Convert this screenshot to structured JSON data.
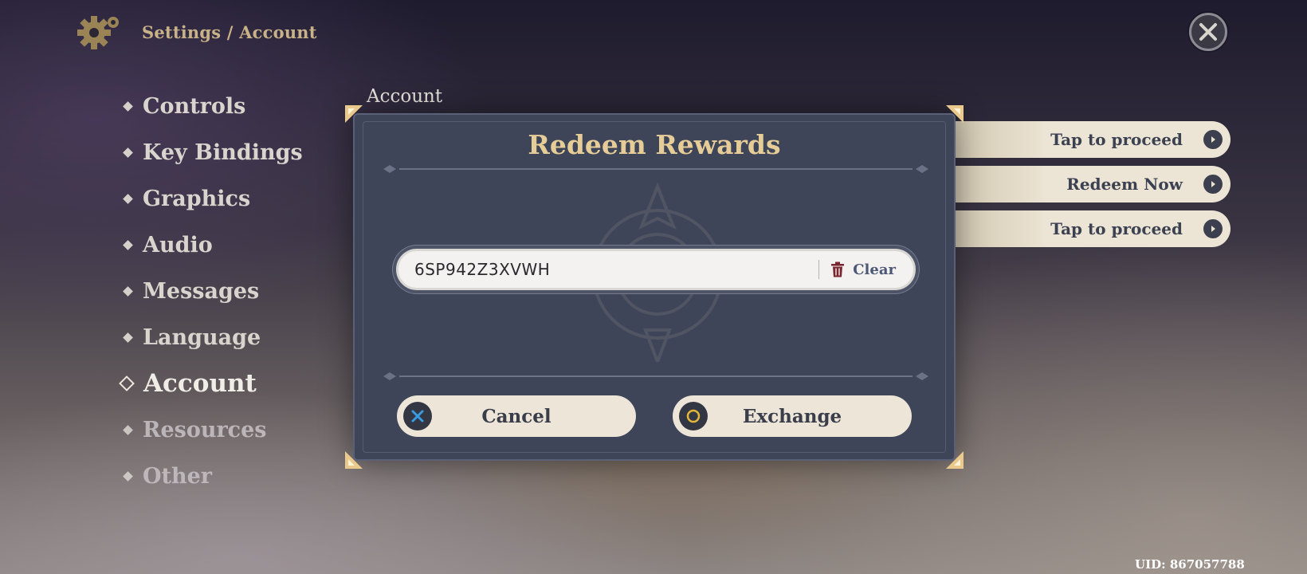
{
  "header": {
    "breadcrumb": "Settings / Account"
  },
  "nav": {
    "items": [
      {
        "label": "Controls"
      },
      {
        "label": "Key Bindings"
      },
      {
        "label": "Graphics"
      },
      {
        "label": "Audio"
      },
      {
        "label": "Messages"
      },
      {
        "label": "Language"
      },
      {
        "label": "Account"
      },
      {
        "label": "Resources"
      },
      {
        "label": "Other"
      }
    ],
    "active": "Account"
  },
  "content": {
    "heading": "Account",
    "buttons": [
      {
        "label": "Tap to proceed"
      },
      {
        "label": "Redeem Now"
      },
      {
        "label": "Tap to proceed"
      }
    ]
  },
  "modal": {
    "title": "Redeem Rewards",
    "input_value": "6SP942Z3XVWH",
    "clear_label": "Clear",
    "cancel_label": "Cancel",
    "exchange_label": "Exchange"
  },
  "footer": {
    "uid": "UID: 867057788"
  },
  "colors": {
    "title_gold": "#e6cc97",
    "modal_bg": "#3f4558",
    "button_bg": "#ece5d8",
    "cancel_icon": "#3b9be0",
    "exchange_icon": "#e3b63a",
    "clear_icon": "#7a2630"
  },
  "icons": {
    "header": "gear-icon",
    "close": "close-icon",
    "clear": "trash-icon",
    "cancel": "cross-icon",
    "exchange": "circle-icon",
    "side_button": "arrow-right-icon"
  }
}
